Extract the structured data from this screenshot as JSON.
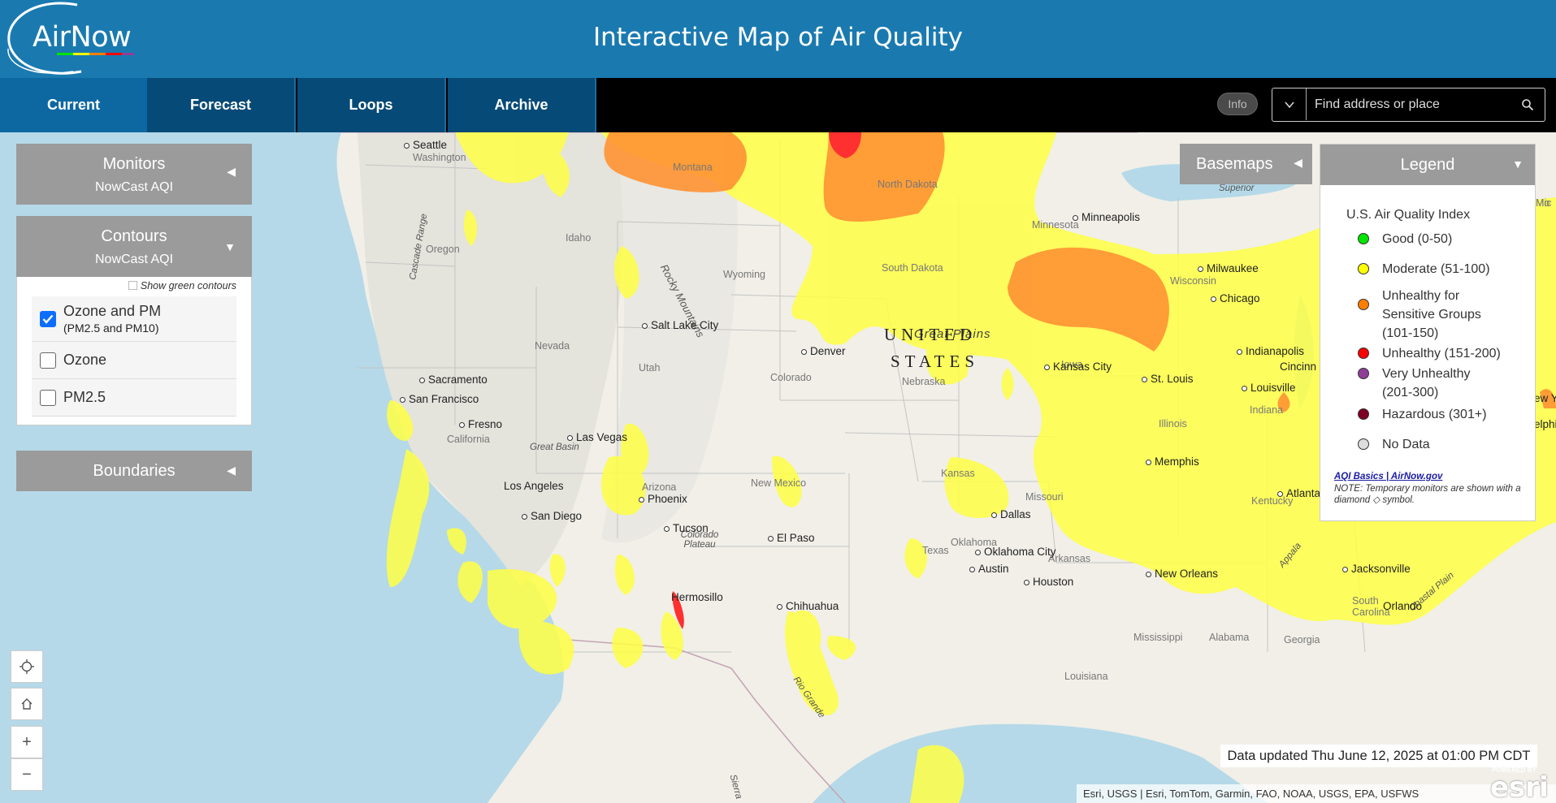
{
  "header": {
    "logo_text": "AirNow",
    "title": "Interactive Map of Air Quality"
  },
  "nav": {
    "tabs": [
      {
        "label": "Current"
      },
      {
        "label": "Forecast"
      },
      {
        "label": "Loops"
      },
      {
        "label": "Archive"
      }
    ],
    "active_tab": "Current",
    "info_label": "Info",
    "search": {
      "placeholder": "Find address or place",
      "value": ""
    }
  },
  "panels": {
    "monitors": {
      "title": "Monitors",
      "subtitle": "NowCast AQI",
      "state": "collapsed"
    },
    "contours": {
      "title": "Contours",
      "subtitle": "NowCast AQI",
      "state": "expanded",
      "show_green_label": "Show green contours",
      "show_green_checked": false,
      "options": [
        {
          "label": "Ozone and PM",
          "sublabel": "(PM2.5 and PM10)",
          "checked": true
        },
        {
          "label": "Ozone",
          "sublabel": "",
          "checked": false
        },
        {
          "label": "PM2.5",
          "sublabel": "",
          "checked": false
        }
      ]
    },
    "boundaries": {
      "title": "Boundaries",
      "state": "collapsed"
    }
  },
  "basemaps": {
    "label": "Basemaps"
  },
  "legend": {
    "header": "Legend",
    "title": "U.S. Air Quality Index",
    "items": [
      {
        "label": "Good (0-50)",
        "color": "#00e400"
      },
      {
        "label": "Moderate (51-100)",
        "color": "#ffff00"
      },
      {
        "label": "Unhealthy for Sensitive Groups (101-150)",
        "color": "#ff7e00"
      },
      {
        "label": "Unhealthy (151-200)",
        "color": "#ff0000"
      },
      {
        "label": "Very Unhealthy (201-300)",
        "color": "#8f3f97"
      },
      {
        "label": "Hazardous (301+)",
        "color": "#7e0023"
      },
      {
        "label": "No Data",
        "color": "#dddddd"
      }
    ],
    "link": "AQI Basics | AirNow.gov",
    "note": "NOTE: Temporary monitors are shown with a diamond ◇ symbol."
  },
  "map": {
    "cities": [
      "Seattle",
      "Salt Lake City",
      "Denver",
      "Sacramento",
      "San Francisco",
      "Fresno",
      "Las Vegas",
      "Los Angeles",
      "San Diego",
      "Phoenix",
      "Tucson",
      "El Paso",
      "Hermosillo",
      "Chihuahua",
      "Minneapolis",
      "Milwaukee",
      "Chicago",
      "Indianapolis",
      "Kansas City",
      "St. Louis",
      "Louisville",
      "Cincinn",
      "Oklahoma City",
      "Memphis",
      "Dallas",
      "Austin",
      "Houston",
      "New Orleans",
      "Atlanta",
      "Jacksonville",
      "Orlando"
    ],
    "states": [
      "Washington",
      "Oregon",
      "Idaho",
      "Montana",
      "Wyoming",
      "Nevada",
      "California",
      "Utah",
      "Colorado",
      "Arizona",
      "New Mexico",
      "Texas",
      "North Dakota",
      "South Dakota",
      "Nebraska",
      "Kansas",
      "Oklahoma",
      "Minnesota",
      "Iowa",
      "Wisconsin",
      "Illinois",
      "Indiana",
      "Kentucky",
      "Missouri",
      "Arkansas",
      "Mississippi",
      "Alabama",
      "Georgia",
      "Louisiana",
      "South Carolina",
      "Mic"
    ],
    "regions": [
      "Great Plains",
      "Great Basin",
      "Colorado Plateau",
      "Rocky Mountains",
      "Cascade Range",
      "Superior",
      "Appala",
      "Coastal Plain",
      "Rio Grande",
      "Sierra",
      "Mo",
      "ew Y",
      "elphi"
    ],
    "nation_line1": "UNITED",
    "nation_line2": "STATES",
    "aqi_contour_colors": {
      "moderate": "#ffff00",
      "usg": "#ff7e00",
      "unhealthy": "#ff0000"
    }
  },
  "controls": {
    "locate_icon": "crosshair-icon",
    "home_icon": "home-icon",
    "zoom_in": "+",
    "zoom_out": "−"
  },
  "footer": {
    "updated": "Data updated Thu June 12, 2025 at 01:00 PM CDT",
    "attribution": "Esri, USGS | Esri, TomTom, Garmin, FAO, NOAA, USGS, EPA, USFWS",
    "esri_powered": "POWERED BY",
    "esri_logo": "esri"
  }
}
